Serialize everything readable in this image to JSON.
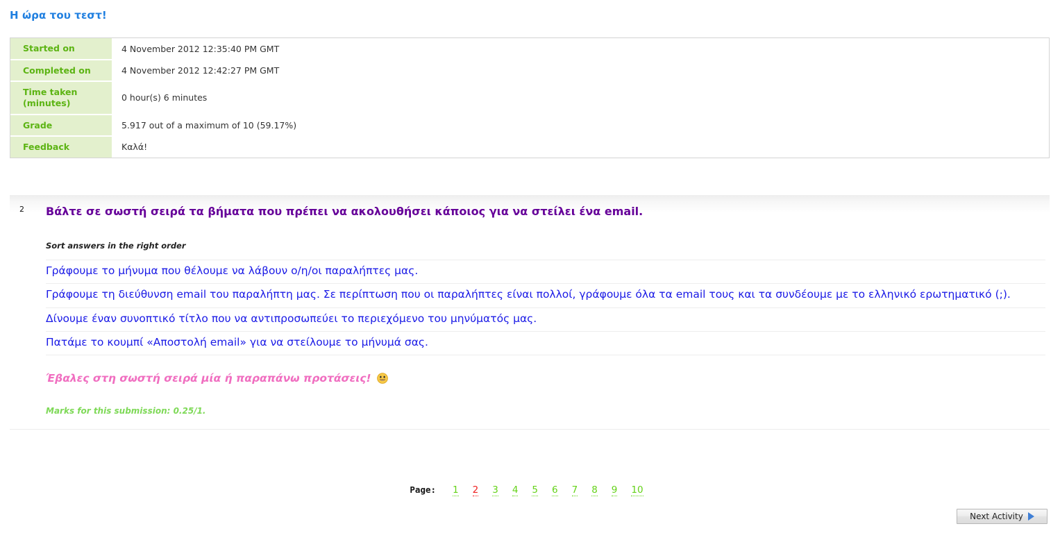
{
  "page": {
    "title": "Η ώρα του τεστ!"
  },
  "summary": {
    "rows": [
      {
        "label": "Started on",
        "value": "4 November 2012 12:35:40 PM GMT"
      },
      {
        "label": "Completed on",
        "value": "4 November 2012 12:42:27 PM GMT"
      },
      {
        "label": "Time taken (minutes)",
        "value": "0 hour(s) 6 minutes"
      },
      {
        "label": "Grade",
        "value": "5.917 out of a maximum of 10 (59.17%)"
      },
      {
        "label": "Feedback",
        "value": "Καλά!"
      }
    ]
  },
  "question": {
    "number": "2",
    "text": "Βάλτε σε σωστή σειρά τα βήματα που πρέπει να ακολουθήσει κάποιος για να στείλει ένα email.",
    "instruction": "Sort answers in the right order",
    "answers": [
      "Γράφουμε το μήνυμα που θέλουμε να λάβουν ο/η/οι παραλήπτες μας.",
      "Γράφουμε τη διεύθυνση email του παραλήπτη μας. Σε περίπτωση που οι παραλήπτες είναι πολλοί, γράφουμε όλα τα email τους και τα συνδέουμε με το ελληνικό ερωτηματικό (;).",
      "Δίνουμε έναν συνοπτικό τίτλο που να αντιπροσωπεύει το περιεχόμενο του μηνύματός μας.",
      "Πατάμε το κουμπί «Αποστολή email» για να στείλουμε το μήνυμά σας."
    ],
    "feedback": "Έβαλες στη σωστή σειρά μία ή παραπάνω προτάσεις!",
    "feedback_icon": "smiley-face-icon",
    "marks": "Marks for this submission: 0.25/1."
  },
  "pagination": {
    "label": "Page:",
    "pages": [
      "1",
      "2",
      "3",
      "4",
      "5",
      "6",
      "7",
      "8",
      "9",
      "10"
    ],
    "current": "2"
  },
  "footer": {
    "next_activity_label": "Next Activity"
  },
  "colors": {
    "title_blue": "#1f7fe0",
    "label_green": "#5cb413",
    "label_bg": "#e3f0cd",
    "question_purple": "#660099",
    "answer_blue": "#1a1ae6",
    "feedback_pink": "#f06ec0",
    "marks_green": "#7ed957",
    "page_link_green": "#64d218",
    "page_current_red": "#ef2020",
    "arrow_blue": "#3f7fd6"
  }
}
